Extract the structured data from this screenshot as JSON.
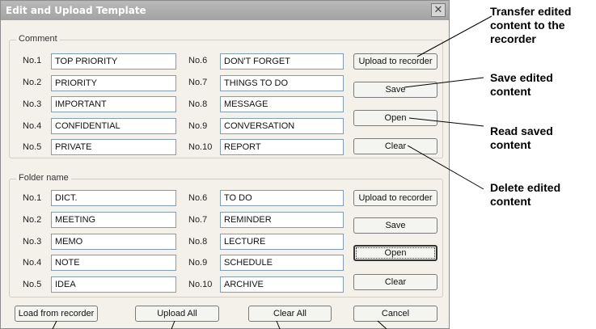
{
  "window": {
    "title": "Edit and Upload Template",
    "close_glyph": "✕"
  },
  "comment_group": {
    "title": "Comment",
    "rows_left": [
      {
        "num": "No.1",
        "value": "TOP PRIORITY"
      },
      {
        "num": "No.2",
        "value": "PRIORITY"
      },
      {
        "num": "No.3",
        "value": "IMPORTANT"
      },
      {
        "num": "No.4",
        "value": "CONFIDENTIAL"
      },
      {
        "num": "No.5",
        "value": "PRIVATE"
      }
    ],
    "rows_right": [
      {
        "num": "No.6",
        "value": "DON'T FORGET"
      },
      {
        "num": "No.7",
        "value": "THINGS TO DO"
      },
      {
        "num": "No.8",
        "value": "MESSAGE"
      },
      {
        "num": "No.9",
        "value": "CONVERSATION"
      },
      {
        "num": "No.10",
        "value": "REPORT"
      }
    ],
    "buttons": {
      "upload": "Upload to recorder",
      "save": "Save",
      "open": "Open",
      "clear": "Clear"
    }
  },
  "folder_group": {
    "title": "Folder name",
    "rows_left": [
      {
        "num": "No.1",
        "value": "DICT."
      },
      {
        "num": "No.2",
        "value": "MEETING"
      },
      {
        "num": "No.3",
        "value": "MEMO"
      },
      {
        "num": "No.4",
        "value": "NOTE"
      },
      {
        "num": "No.5",
        "value": "IDEA"
      }
    ],
    "rows_right": [
      {
        "num": "No.6",
        "value": "TO DO"
      },
      {
        "num": "No.7",
        "value": "REMINDER"
      },
      {
        "num": "No.8",
        "value": "LECTURE"
      },
      {
        "num": "No.9",
        "value": "SCHEDULE"
      },
      {
        "num": "No.10",
        "value": "ARCHIVE"
      }
    ],
    "buttons": {
      "upload": "Upload to recorder",
      "save": "Save",
      "open": "Open",
      "clear": "Clear"
    }
  },
  "bottom_buttons": {
    "load": "Load from recorder",
    "upload_all": "Upload All",
    "clear_all": "Clear All",
    "cancel": "Cancel"
  },
  "callouts": {
    "transfer": "Transfer edited content to the recorder",
    "save": "Save edited content",
    "read": "Read saved content",
    "delete": "Delete edited content"
  }
}
